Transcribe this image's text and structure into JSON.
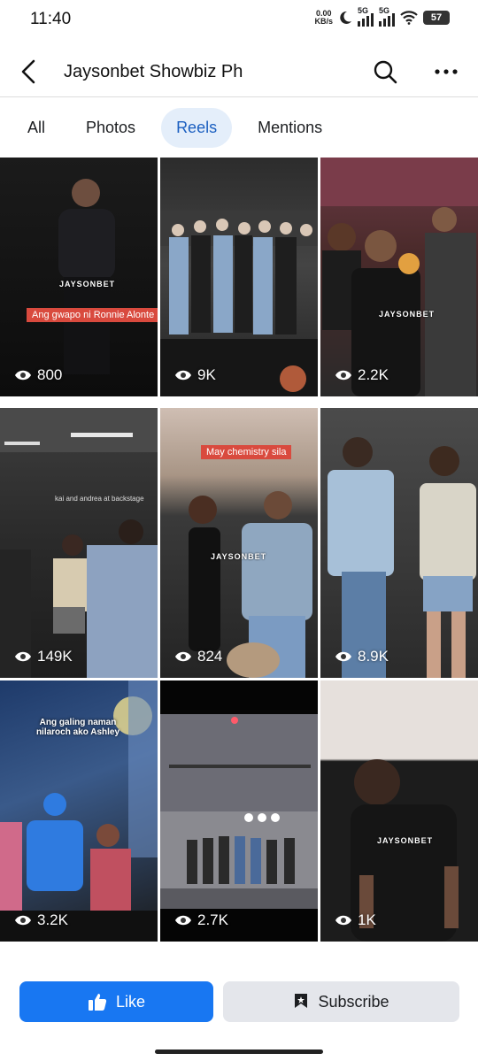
{
  "status": {
    "time": "11:40",
    "net_speed_value": "0.00",
    "net_speed_unit": "KB/s",
    "signal1": "5G",
    "signal2": "5G",
    "battery": "57"
  },
  "header": {
    "title": "Jaysonbet Showbiz Ph",
    "back_icon": "back-arrow-icon",
    "search_icon": "search-icon",
    "more_icon": "more-options-icon"
  },
  "tabs": [
    {
      "label": "All",
      "active": false
    },
    {
      "label": "Photos",
      "active": false
    },
    {
      "label": "Reels",
      "active": true
    },
    {
      "label": "Mentions",
      "active": false
    }
  ],
  "reels": [
    {
      "views": "800",
      "caption": "Ang gwapo ni Ronnie Alonte",
      "watermark": "JAYSONBET"
    },
    {
      "views": "9K"
    },
    {
      "views": "2.2K",
      "watermark": "JAYSONBET"
    },
    {
      "views": "149K",
      "caption": "kai and andrea at backstage"
    },
    {
      "views": "824",
      "caption": "May chemistry sila",
      "watermark": "JAYSONBET"
    },
    {
      "views": "8.9K"
    },
    {
      "views": "3.2K",
      "caption": "Ang galing naman nilaroch ako Ashley"
    },
    {
      "views": "2.7K"
    },
    {
      "views": "1K",
      "watermark": "JAYSONBET"
    }
  ],
  "actions": {
    "like_label": "Like",
    "subscribe_label": "Subscribe"
  },
  "colors": {
    "accent": "#1877f2",
    "active_tab_bg": "#e4eefa",
    "active_tab_text": "#1b5fc0"
  }
}
